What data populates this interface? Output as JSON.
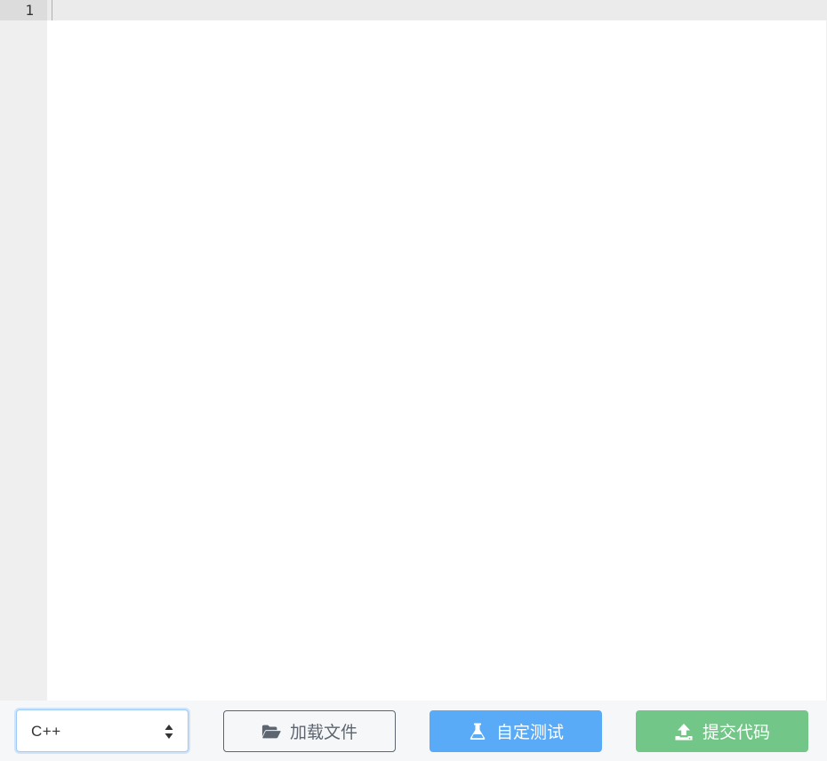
{
  "editor": {
    "line_numbers": [
      "1"
    ],
    "content": ""
  },
  "toolbar": {
    "language": {
      "selected": "C++",
      "icon": "sort-arrows-icon"
    },
    "load_file": {
      "label": "加载文件",
      "icon": "folder-open-icon"
    },
    "custom_test": {
      "label": "自定测试",
      "icon": "flask-icon",
      "color": "#5aabf7"
    },
    "submit_code": {
      "label": "提交代码",
      "icon": "upload-icon",
      "color": "#72c687"
    }
  }
}
